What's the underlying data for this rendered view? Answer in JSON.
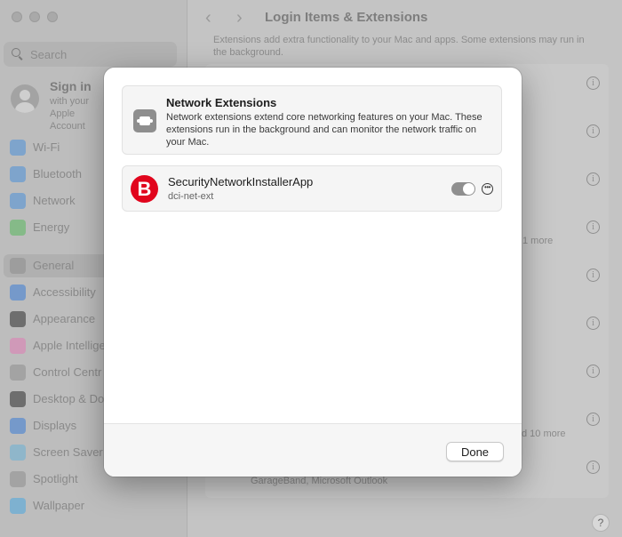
{
  "window": {
    "title": "Login Items & Extensions"
  },
  "sidebar": {
    "search_placeholder": "Search",
    "account": {
      "title": "Sign in",
      "subtitle": "with your Apple Account"
    },
    "items": [
      {
        "label": "Wi-Fi",
        "icon": "wifi-icon",
        "color": "#4a90d9"
      },
      {
        "label": "Bluetooth",
        "icon": "bluetooth-icon",
        "color": "#4a90d9"
      },
      {
        "label": "Network",
        "icon": "network-icon",
        "color": "#4a90d9"
      },
      {
        "label": "Energy",
        "icon": "energy-icon",
        "color": "#58b85c"
      },
      {
        "label": "General",
        "icon": "gear-icon",
        "color": "#8e8e8e"
      },
      {
        "label": "Accessibility",
        "icon": "accessibility-icon",
        "color": "#3a7bd5"
      },
      {
        "label": "Appearance",
        "icon": "appearance-icon",
        "color": "#2d2d2d"
      },
      {
        "label": "Apple Intellige",
        "icon": "apple-intelligence-icon",
        "color": "#e07bb5"
      },
      {
        "label": "Control Centr",
        "icon": "control-centre-icon",
        "color": "#8e8e8e"
      },
      {
        "label": "Desktop & Do",
        "icon": "desktop-dock-icon",
        "color": "#2d2d2d"
      },
      {
        "label": "Displays",
        "icon": "displays-icon",
        "color": "#3a7bd5"
      },
      {
        "label": "Screen Saver",
        "icon": "screen-saver-icon",
        "color": "#6ab0d6"
      },
      {
        "label": "Spotlight",
        "icon": "spotlight-icon",
        "color": "#8e8e8e"
      },
      {
        "label": "Wallpaper",
        "icon": "wallpaper-icon",
        "color": "#4aa8e0"
      }
    ]
  },
  "background": {
    "intro": "Extensions add extra functionality to your Mac and apps. Some extensions may run in the background.",
    "more_1": "1 more",
    "more_2": "d 10 more",
    "last_row_text": "GarageBand, Microsoft Outlook"
  },
  "modal": {
    "header": {
      "icon": "extension-icon",
      "title": "Network Extensions",
      "description": "Network extensions extend core networking features on your Mac. These extensions run in the background and can monitor the network traffic on your Mac."
    },
    "extension": {
      "logo_letter": "B",
      "logo_color": "#e1051d",
      "name": "SecurityNetworkInstallerApp",
      "identifier": "dci-net-ext",
      "enabled": true
    },
    "done_label": "Done"
  },
  "help_label": "?",
  "info_glyph": "i"
}
